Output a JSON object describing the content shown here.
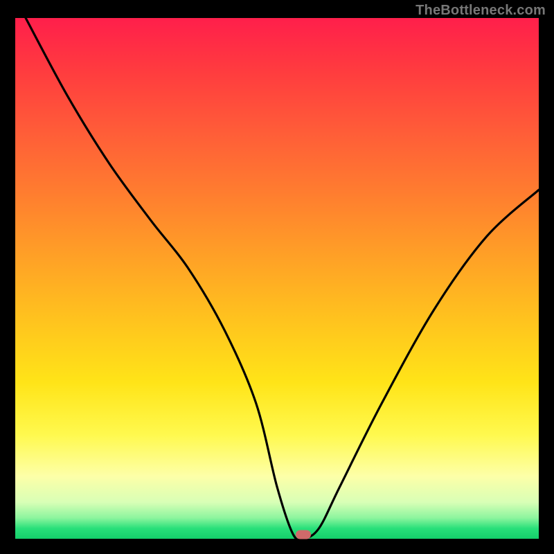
{
  "watermark": "TheBottleneck.com",
  "chart_data": {
    "type": "line",
    "title": "",
    "xlabel": "",
    "ylabel": "",
    "xlim": [
      0,
      100
    ],
    "ylim": [
      0,
      100
    ],
    "grid": false,
    "background": "rainbow-gradient-vertical",
    "series": [
      {
        "name": "bottleneck-curve",
        "x": [
          2,
          10,
          18,
          26,
          33,
          40,
          46,
          50,
          53,
          55,
          58,
          62,
          70,
          80,
          90,
          100
        ],
        "values": [
          100,
          85,
          72,
          61,
          52,
          40,
          26,
          10,
          1,
          0,
          2,
          10,
          26,
          44,
          58,
          67
        ]
      }
    ],
    "marker": {
      "x": 55,
      "y": 0,
      "color": "#cf6a6a"
    },
    "gradient_stops": [
      {
        "pct": 0,
        "color": "#ff1f4b"
      },
      {
        "pct": 50,
        "color": "#ffb822"
      },
      {
        "pct": 80,
        "color": "#fff94e"
      },
      {
        "pct": 100,
        "color": "#14cf6a"
      }
    ]
  }
}
